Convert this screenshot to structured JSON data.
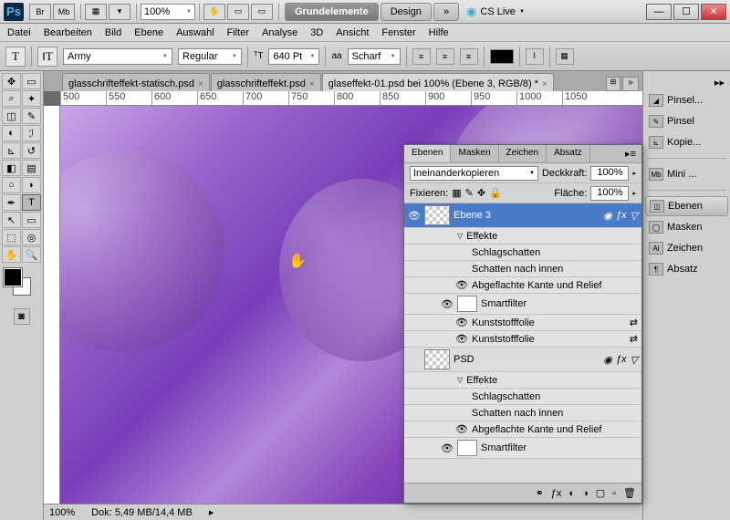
{
  "titlebar": {
    "ps": "Ps",
    "br": "Br",
    "mb": "Mb",
    "zoom": "100%",
    "ws1": "Grundelemente",
    "ws2": "Design",
    "cslive": "CS Live"
  },
  "menu": [
    "Datei",
    "Bearbeiten",
    "Bild",
    "Ebene",
    "Auswahl",
    "Filter",
    "Analyse",
    "3D",
    "Ansicht",
    "Fenster",
    "Hilfe"
  ],
  "options": {
    "font": "Army",
    "weight": "Regular",
    "size": "640 Pt",
    "aa_label": "aa",
    "aa": "Scharf"
  },
  "tabs": [
    {
      "label": "glasschrifteffekt-statisch.psd",
      "active": false
    },
    {
      "label": "glasschrifteffekt.psd",
      "active": false
    },
    {
      "label": "glaseffekt-01.psd bei 100% (Ebene 3, RGB/8) *",
      "active": true
    }
  ],
  "ruler": [
    "500",
    "550",
    "600",
    "650",
    "700",
    "750",
    "800",
    "850",
    "900",
    "950",
    "1000",
    "1050"
  ],
  "status": {
    "zoom": "100%",
    "doc": "Dok: 5,49 MB/14,4 MB"
  },
  "rightpanel": [
    "Pinsel...",
    "Pinsel",
    "Kopie...",
    "Mini ...",
    "Ebenen",
    "Masken",
    "Zeichen",
    "Absatz"
  ],
  "rightLabels": {
    "mb": "Mb",
    "al": "Al"
  },
  "layerpanel": {
    "tabs": [
      "Ebenen",
      "Masken",
      "Zeichen",
      "Absatz"
    ],
    "blend": "Ineinanderkopieren",
    "opacity_label": "Deckkraft:",
    "opacity": "100%",
    "lock_label": "Fixieren:",
    "fill_label": "Fläche:",
    "fill": "100%",
    "layers": [
      {
        "name": "Ebene 3",
        "selected": true,
        "fx": true
      },
      {
        "sub": true,
        "arrow": "▽",
        "name": "Effekte"
      },
      {
        "sub2": true,
        "name": "Schlagschatten"
      },
      {
        "sub2": true,
        "name": "Schatten nach innen"
      },
      {
        "sub2": true,
        "eye": true,
        "name": "Abgeflachte Kante und Relief"
      },
      {
        "sub": true,
        "eye": true,
        "thumb": true,
        "name": "Smartfilter"
      },
      {
        "sub2": true,
        "eye": true,
        "name": "Kunststofffolie"
      },
      {
        "sub2": true,
        "eye": true,
        "name": "Kunststofffolie"
      },
      {
        "name": "PSD",
        "fx": true
      },
      {
        "sub": true,
        "arrow": "▽",
        "name": "Effekte"
      },
      {
        "sub2": true,
        "name": "Schlagschatten"
      },
      {
        "sub2": true,
        "name": "Schatten nach innen"
      },
      {
        "sub2": true,
        "eye": true,
        "name": "Abgeflachte Kante und Relief"
      },
      {
        "sub": true,
        "eye": true,
        "thumb": true,
        "name": "Smartfilter"
      }
    ]
  }
}
